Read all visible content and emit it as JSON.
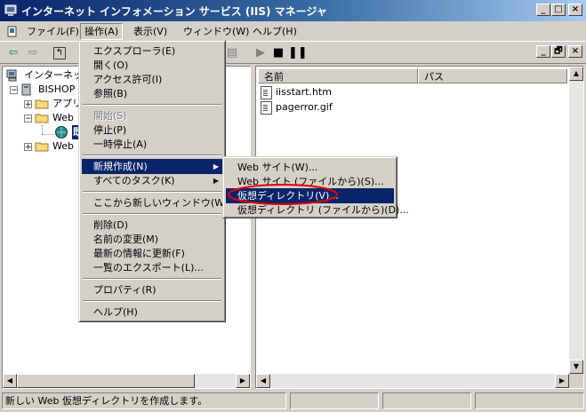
{
  "window": {
    "title": "インターネット インフォメーション サービス (IIS) マネージャ",
    "caption_buttons": {
      "minimize": "_",
      "maximize": "□",
      "close": "×"
    },
    "mdi_buttons": {
      "minimize": "_",
      "restore": "🗗",
      "close": "×"
    }
  },
  "menubar": {
    "items": [
      {
        "label": "ファイル(F)"
      },
      {
        "label": "操作(A)"
      },
      {
        "label": "表示(V)"
      },
      {
        "label": "ウィンドウ(W)"
      },
      {
        "label": "ヘルプ(H)"
      }
    ]
  },
  "tree": {
    "items": [
      {
        "label": "インターネット"
      },
      {
        "label": "BISHOP"
      },
      {
        "label": "アプリ"
      },
      {
        "label": "Web"
      },
      {
        "label": "既"
      },
      {
        "label": "Web"
      }
    ]
  },
  "list": {
    "columns": [
      "名前",
      "パス"
    ],
    "files": [
      "iisstart.htm",
      "pagerror.gif"
    ]
  },
  "action_menu": {
    "items": [
      {
        "label": "エクスプローラ(E)"
      },
      {
        "label": "開く(O)"
      },
      {
        "label": "アクセス許可(I)"
      },
      {
        "label": "参照(B)"
      },
      {
        "label": "開始(S)"
      },
      {
        "label": "停止(P)"
      },
      {
        "label": "一時停止(A)"
      },
      {
        "label": "新規作成(N)"
      },
      {
        "label": "すべてのタスク(K)"
      },
      {
        "label": "ここから新しいウィンドウ(W)"
      },
      {
        "label": "削除(D)"
      },
      {
        "label": "名前の変更(M)"
      },
      {
        "label": "最新の情報に更新(F)"
      },
      {
        "label": "一覧のエクスポート(L)..."
      },
      {
        "label": "プロパティ(R)"
      },
      {
        "label": "ヘルプ(H)"
      }
    ]
  },
  "new_submenu": {
    "items": [
      {
        "label": "Web サイト(W)..."
      },
      {
        "label": "Web サイト (ファイルから)(S)..."
      },
      {
        "label": "仮想ディレクトリ(V)..."
      },
      {
        "label": "仮想ディレクトリ (ファイルから)(D)..."
      }
    ]
  },
  "statusbar": {
    "text": "新しい Web 仮想ディレクトリを作成します。"
  },
  "colors": {
    "title_gradient_start": "#0a246a",
    "highlight": "#0a246a",
    "annotation_circle": "#e00000"
  }
}
